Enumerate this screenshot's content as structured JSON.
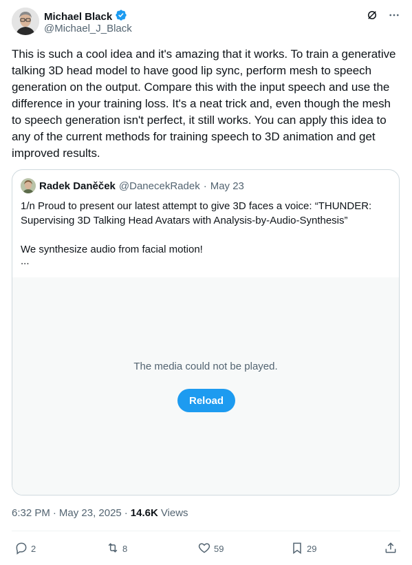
{
  "author": {
    "display_name": "Michael Black",
    "handle": "@Michael_J_Black",
    "verified": true
  },
  "header_icons": [
    "grok-icon",
    "more-icon"
  ],
  "tweet": {
    "text": "This is such a cool idea and it's amazing that it works. To train a generative talking 3D head model to have good lip sync, perform mesh to speech generation on the output. Compare this with the input speech and use the difference in your training loss. It's a neat trick and, even though the mesh to speech generation isn't perfect, it still works. You can apply this idea to any of the current methods for training speech to 3D animation and get improved results."
  },
  "quote": {
    "display_name": "Radek Daněček",
    "handle": "@DanecekRadek",
    "separator": "·",
    "date": "May 23",
    "paragraph1": "1/n Proud to present our latest attempt to give 3D faces a voice: “THUNDER: Supervising 3D Talking Head Avatars with Analysis-by-Audio-Synthesis”",
    "paragraph2": "We synthesize audio from facial motion!",
    "ellipsis": "...",
    "media_message": "The media could not be played.",
    "reload_label": "Reload"
  },
  "meta": {
    "time": "6:32 PM",
    "separator1": "·",
    "date": "May 23, 2025",
    "separator2": "·",
    "views_count": "14.6K",
    "views_label": "Views"
  },
  "actions": {
    "replies": "2",
    "reposts": "8",
    "likes": "59",
    "bookmarks": "29"
  },
  "colors": {
    "accent": "#1d9bf0",
    "muted": "#536471",
    "text": "#0f1419",
    "border": "#cfd9de",
    "media_bg": "#f7f9f9"
  }
}
